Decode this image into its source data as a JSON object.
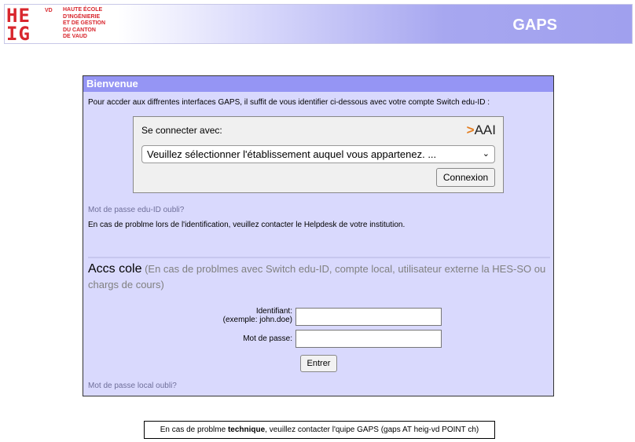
{
  "header": {
    "logo_mark": "HE\nIG",
    "logo_vd": "VD",
    "logo_text_lines": [
      "HAUTE ÉCOLE",
      "D'INGÉNIERIE",
      "ET DE GESTION",
      "DU CANTON",
      "DE VAUD"
    ],
    "app_title": "GAPS"
  },
  "panel": {
    "title": "Bienvenue",
    "intro": "Pour accder aux diffrentes interfaces GAPS, il suffit de vous identifier ci-dessous avec votre compte Switch edu-ID :",
    "aai": {
      "label": "Se connecter avec:",
      "logo_arrow": ">",
      "logo_text": "AAI",
      "select_value": "Veuillez sélectionner l'établissement auquel vous appartenez. ...",
      "connect_button": "Connexion"
    },
    "forgot_eduid": "Mot de passe edu-ID oubli?",
    "problem_info": "En cas de problme lors de l'identification, veuillez contacter le Helpdesk de votre institution.",
    "local": {
      "title": "Accs cole",
      "subtitle": "(En cas de problmes avec Switch edu-ID, compte local, utilisateur externe la HES-SO ou chargs de cours)",
      "identifiant_label": "Identifiant:",
      "identifiant_hint": "(exemple: john.doe)",
      "identifiant_value": "",
      "password_label": "Mot de passe:",
      "password_value": "",
      "submit_button": "Entrer",
      "forgot_local": "Mot de passe local oubli?"
    }
  },
  "footer": {
    "prefix": "En cas de problme ",
    "bold": "technique",
    "suffix": ", veuillez contacter l'quipe GAPS (gaps AT heig-vd POINT ch)"
  }
}
